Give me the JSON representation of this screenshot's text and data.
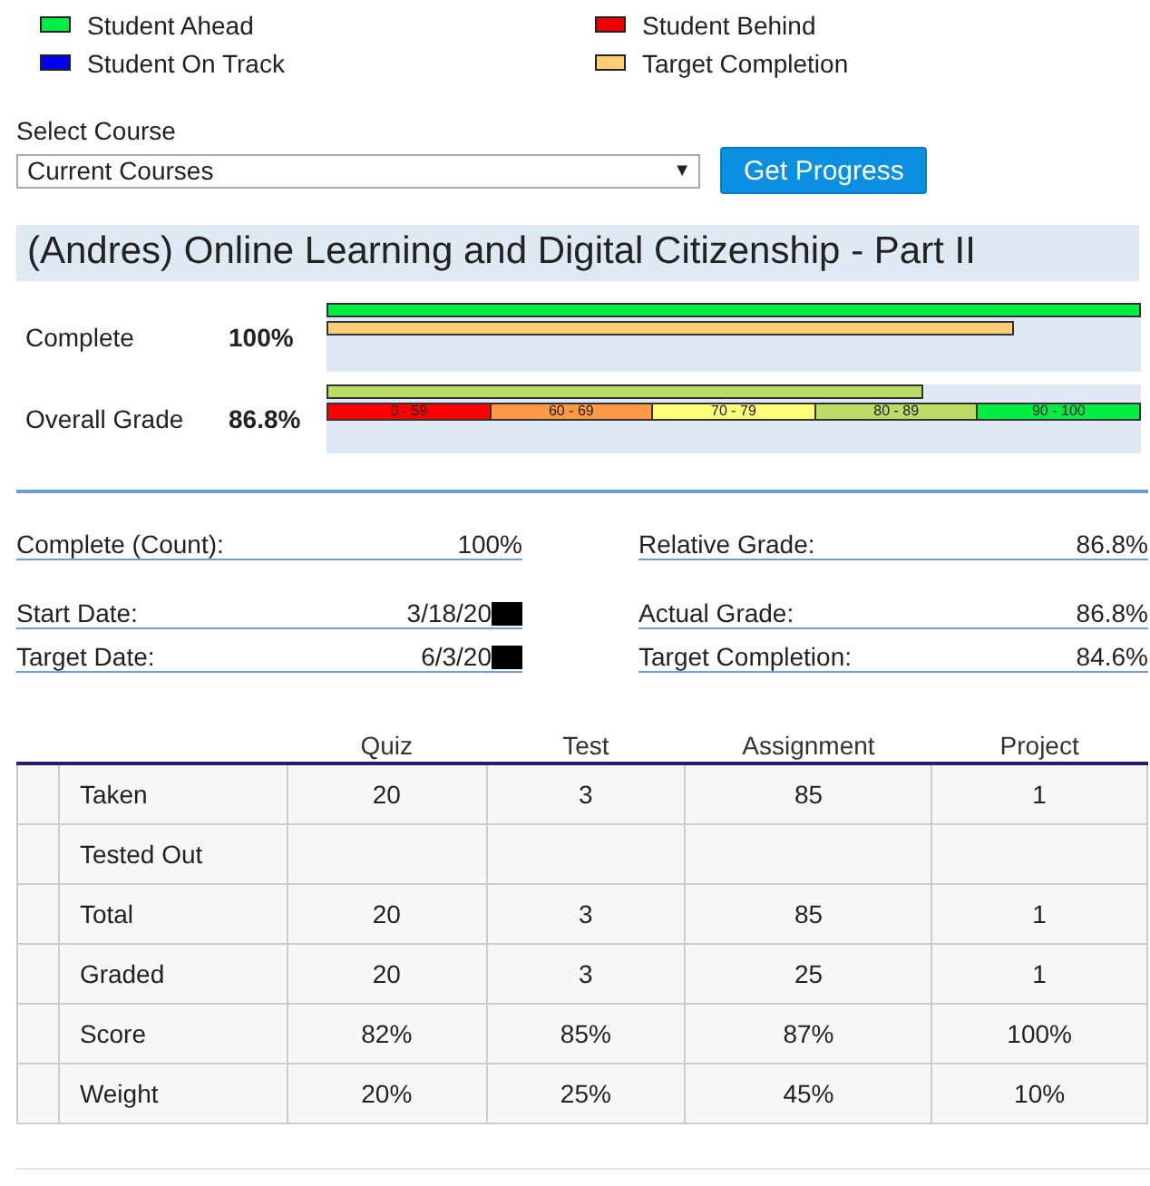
{
  "legend": [
    {
      "label": "Student Ahead",
      "color": "#00ee44"
    },
    {
      "label": "Student Behind",
      "color": "#ee0000"
    },
    {
      "label": "Student On Track",
      "color": "#0000ee"
    },
    {
      "label": "Target Completion",
      "color": "#ffcc77"
    }
  ],
  "course_select": {
    "label": "Select Course",
    "value": "Current Courses",
    "arrow": "▼"
  },
  "get_progress_button": "Get Progress",
  "course_title": "(Andres) Online Learning and Digital Citizenship - Part II",
  "complete": {
    "label": "Complete",
    "value": "100%",
    "bars": [
      {
        "kind": "progress",
        "level": 1.0
      },
      {
        "kind": "target",
        "level": 0.844
      }
    ]
  },
  "overall_grade": {
    "label": "Overall Grade",
    "value": "86.8%",
    "level": 0.733,
    "bands": [
      {
        "label": "0 - 59",
        "color": "#ff0000"
      },
      {
        "label": "60 - 69",
        "color": "#ff9944"
      },
      {
        "label": "70 - 79",
        "color": "#ffff77"
      },
      {
        "label": "80 - 89",
        "color": "#bbdd66"
      },
      {
        "label": "90 - 100",
        "color": "#00ee44"
      }
    ]
  },
  "details_left": [
    {
      "label": "Complete (Count):",
      "value": "100%",
      "redacted": false
    },
    {
      "label": "Start Date:",
      "value": "3/18/20",
      "redacted": true
    },
    {
      "label": "Target Date:",
      "value": "6/3/20",
      "redacted": true
    }
  ],
  "details_right": [
    {
      "label": "Relative Grade:",
      "value": "86.8%"
    },
    {
      "label": "Actual Grade:",
      "value": "86.8%"
    },
    {
      "label": "Target Completion:",
      "value": "84.6%"
    }
  ],
  "table": {
    "columns": [
      "Quiz",
      "Test",
      "Assignment",
      "Project"
    ],
    "rows": [
      {
        "label": "Taken",
        "cells": [
          "20",
          "3",
          "85",
          "1"
        ]
      },
      {
        "label": "Tested Out",
        "cells": []
      },
      {
        "label": "Total",
        "cells": [
          "20",
          "3",
          "85",
          "1"
        ]
      },
      {
        "label": "Graded",
        "cells": [
          "20",
          "3",
          "25",
          "1"
        ]
      },
      {
        "label": "Score",
        "cells": [
          "82%",
          "85%",
          "87%",
          "100%"
        ]
      },
      {
        "label": "Weight",
        "cells": [
          "20%",
          "25%",
          "45%",
          "10%"
        ]
      }
    ]
  }
}
